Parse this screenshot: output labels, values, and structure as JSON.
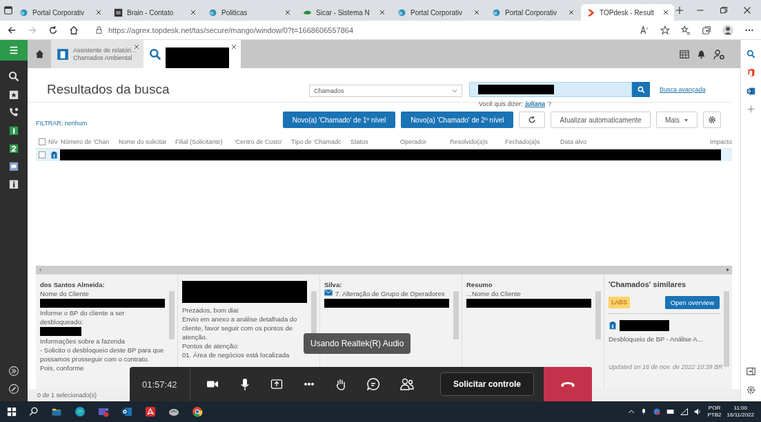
{
  "browser": {
    "tabs": [
      {
        "title": "Portal Corporativ",
        "kind": "portal",
        "selected": false
      },
      {
        "title": "Brain - Contato",
        "kind": "brain",
        "selected": false
      },
      {
        "title": "Politicas",
        "kind": "portal",
        "selected": false
      },
      {
        "title": "Sicar - Sistema N",
        "kind": "sicar",
        "selected": false
      },
      {
        "title": "Portal Corporativ",
        "kind": "portal",
        "selected": false
      },
      {
        "title": "Portal Corporativ",
        "kind": "portal",
        "selected": false
      },
      {
        "title": "TOPdesk - Result",
        "kind": "topdesk",
        "selected": true
      }
    ],
    "url": "https://agrex.topdesk.net/tas/secure/mango/window/0?t=1668606557864"
  },
  "app_tabs": [
    {
      "title": "Assistente de relatóri...",
      "subtitle": "Chamados Ambiental",
      "selected": false
    },
    {
      "selected": true
    }
  ],
  "search_page": {
    "title": "Resultados da busca",
    "category": "Chamados",
    "suggestion_label": "Você quis dizer:",
    "suggestion": "juliana",
    "suggestion_mark": "?",
    "advanced_link": "Busca avançada"
  },
  "toolbar": {
    "filter": "FILTRAR: nenhum",
    "buttons": [
      "Novo(a) 'Chamado' de 1º nível",
      "Novo(a) 'Chamado' de 2º nível"
    ],
    "auto_refresh": "Atualizar automaticamente",
    "more": "Mais"
  },
  "table": {
    "select_all_checked": false,
    "columns": [
      "Nív",
      "Número de 'Chan",
      "Nome do solicitar",
      "Filial (Solicitante)",
      "'Centro de Custo'",
      "Tipo de 'Chamadc",
      "Status",
      "Operador",
      "Resolvido(a)s",
      "Fechado(a)s",
      "Data alvo",
      "Impacto"
    ],
    "rows": [
      {
        "checked": false,
        "selected": true
      }
    ]
  },
  "panels": [
    {
      "blocks": [
        {
          "kind": "heading",
          "text": "dos Santos Almeida:"
        },
        {
          "kind": "text",
          "text": "Nome do Cliente"
        },
        {
          "kind": "redacted"
        },
        {
          "kind": "text",
          "text": "Informe o BP do cliente a ser desbloqueado:"
        },
        {
          "kind": "redacted_short"
        },
        {
          "kind": "text",
          "text": "Informações sobre a fazenda"
        },
        {
          "kind": "text",
          "text": "- Solicito o desbloqueio deste BP para que possamos prosseguir com o contrato. Pois, conforme"
        }
      ]
    },
    {
      "blocks": [
        {
          "kind": "redacted_tall"
        },
        {
          "kind": "text",
          "text": "Prezados, bom dia!"
        },
        {
          "kind": "text",
          "text": "Envio em anexo a análise detalhada do cliente, favor seguir com os pontos de atenção."
        },
        {
          "kind": "text",
          "text": "Pontos de atenção:"
        },
        {
          "kind": "text",
          "text": "01. Área de negócios está localizada"
        }
      ]
    },
    {
      "blocks": [
        {
          "kind": "heading",
          "text": "Silva:"
        },
        {
          "kind": "mail",
          "text": "7. Alteração de Grupo de Operadores"
        },
        {
          "kind": "redacted"
        }
      ]
    },
    {
      "blocks": [
        {
          "kind": "heading",
          "text": "Resumo"
        },
        {
          "kind": "text",
          "text": "...Nome do Cliente"
        },
        {
          "kind": "redacted"
        }
      ]
    }
  ],
  "similar": {
    "title": "'Chamados' similares",
    "badge": "LABS",
    "button": "Open overview",
    "item_text": "Desbloqueio de BP - Análise A...",
    "updated": "Updated on 16 de nov. de 2022 10:39 BR"
  },
  "status_bar": "0 de 1 selecionado(s)",
  "tooltip": "Usando Realtek(R) Audio",
  "call_bar": {
    "timer": "01:57:42",
    "control_button": "Solicitar controle"
  },
  "taskbar": {
    "language": "POR",
    "layout": "PTB2",
    "time": "11:00",
    "date": "16/11/2022"
  }
}
